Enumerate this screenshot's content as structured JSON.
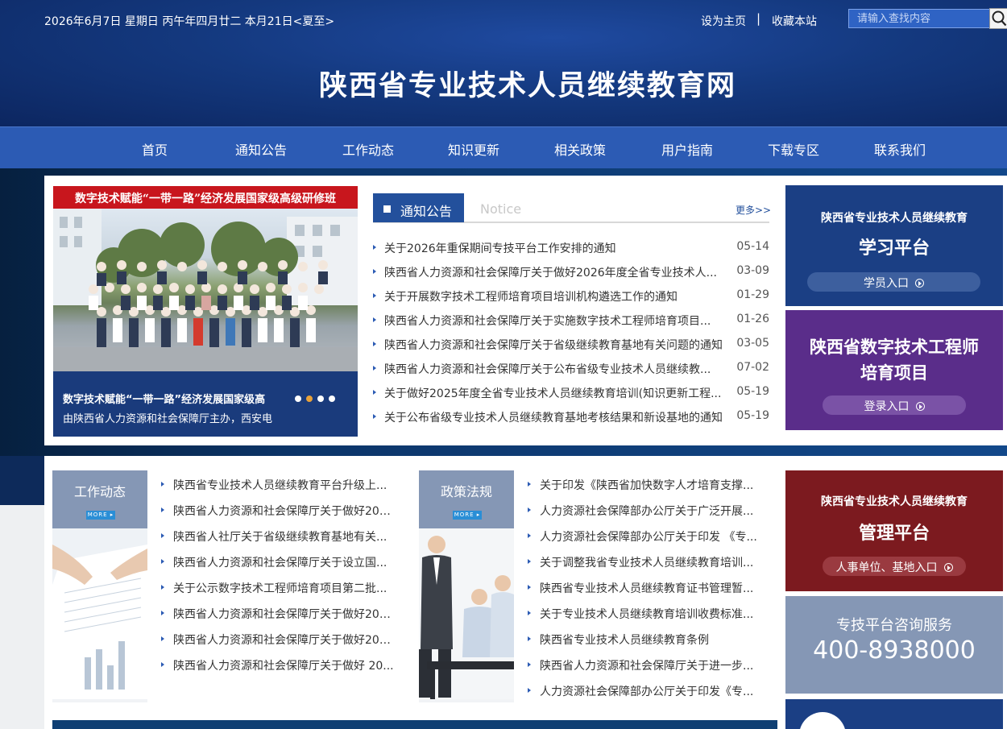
{
  "header": {
    "date_line": "2026年6月7日  星期日  丙午年四月廿二  本月21日<夏至>",
    "set_home": "设为主页",
    "separator": "|",
    "bookmark": "收藏本站",
    "search_placeholder": "请输入查找内容",
    "site_title": "陕西省专业技术人员继续教育网"
  },
  "nav": [
    "首页",
    "通知公告",
    "工作动态",
    "知识更新",
    "相关政策",
    "用户指南",
    "下载专区",
    "联系我们"
  ],
  "slider": {
    "banner": "数字技术赋能“一带一路”经济发展国家级高级研修班",
    "caption_title": "数字技术赋能“一带一路”经济发展国家级高",
    "caption_text": "由陕西省人力资源和社会保障厅主办，西安电",
    "active_dot": 2,
    "dot_count": 4
  },
  "notice": {
    "tab_label": "通知公告",
    "en_label": "Notice",
    "more": "更多>>",
    "items": [
      {
        "title": "关于2026年重保期间专技平台工作安排的通知",
        "date": "05-14"
      },
      {
        "title": "陕西省人力资源和社会保障厅关于做好2026年度全省专业技术人...",
        "date": "03-09"
      },
      {
        "title": "关于开展数字技术工程师培育项目培训机构遴选工作的通知",
        "date": "01-29"
      },
      {
        "title": "陕西省人力资源和社会保障厅关于实施数字技术工程师培育项目...",
        "date": "01-26"
      },
      {
        "title": "陕西省人力资源和社会保障厅关于省级继续教育基地有关问题的通知",
        "date": "03-05"
      },
      {
        "title": "陕西省人力资源和社会保障厅关于公布省级专业技术人员继续教...",
        "date": "07-02"
      },
      {
        "title": "关于做好2025年度全省专业技术人员继续教育培训(知识更新工程...",
        "date": "05-19"
      },
      {
        "title": "关于公布省级专业技术人员继续教育基地考核结果和新设基地的通知",
        "date": "05-19"
      }
    ]
  },
  "cards": {
    "study": {
      "sub": "陕西省专业技术人员继续教育",
      "title": "学习平台",
      "button": "学员入口"
    },
    "digital": {
      "title_line1": "陕西省数字技术工程师",
      "title_line2": "培育项目",
      "button": "登录入口"
    },
    "manage": {
      "sub": "陕西省专业技术人员继续教育",
      "title": "管理平台",
      "button": "人事单位、基地入口"
    },
    "consult": {
      "title": "专技平台咨询服务",
      "phone": "400-8938000"
    }
  },
  "work": {
    "title": "工作动态",
    "more": "MORE ▸",
    "items": [
      "陕西省专业技术人员继续教育平台升级上...",
      "陕西省人力资源和社会保障厅关于做好202...",
      "陕西省人社厅关于省级继续教育基地有关...",
      "陕西省人力资源和社会保障厅关于设立国...",
      "关于公示数字技术工程师培育项目第二批...",
      "陕西省人力资源和社会保障厅关于做好202...",
      "陕西省人力资源和社会保障厅关于做好202...",
      "陕西省人力资源和社会保障厅关于做好 20..."
    ]
  },
  "policy": {
    "title": "政策法规",
    "more": "MORE ▸",
    "items": [
      "关于印发《陕西省加快数字人才培育支撑...",
      "人力资源社会保障部办公厅关于广泛开展...",
      "人力资源社会保障部办公厅关于印发 《专...",
      "关于调整我省专业技术人员继续教育培训...",
      "陕西省专业技术人员继续教育证书管理暂...",
      "关于专业技术人员继续教育培训收费标准...",
      "陕西省专业技术人员继续教育条例",
      "陕西省人力资源和社会保障厅关于进一步...",
      "人力资源社会保障部办公厅关于印发《专..."
    ]
  },
  "colors": {
    "nav": "#2c5bb4",
    "notice_tab": "#23509c",
    "study_card": "#1b3f84",
    "digital_card": "#5a2d8a",
    "manage_card": "#7c1a1f",
    "consult_card": "#8597b5",
    "slider_dot_active": "#e8a23a"
  }
}
